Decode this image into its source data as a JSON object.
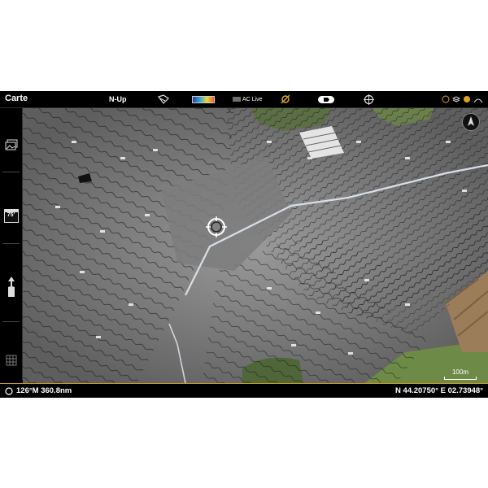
{
  "topbar": {
    "title": "Carte",
    "orientation": "N-Up",
    "ac_live": "AC Live"
  },
  "sidebar": {
    "range_value": "75'"
  },
  "status": {
    "heading_distance": "126°M 360.8nm",
    "coordinates": "N 44.20750° E 02.73948°"
  },
  "map": {
    "scale_label": "100m"
  },
  "colors": {
    "accent": "#c89a2c",
    "bar_bg": "#000000",
    "map_grey": "#7a7a7a",
    "field_green": "#5f7a3a",
    "water_highlight": "#dfe6ee"
  },
  "icons": {
    "sidebar": [
      "image-view-icon",
      "range-75-icon",
      "boat-icon",
      "grid-icon"
    ],
    "topbar": [
      "chart-tilt-icon",
      "color-palette-bar",
      "ac-live-icon",
      "satellite-icon",
      "boat-toggle-icon",
      "crosshair-icon",
      "gps-status-icons"
    ]
  }
}
